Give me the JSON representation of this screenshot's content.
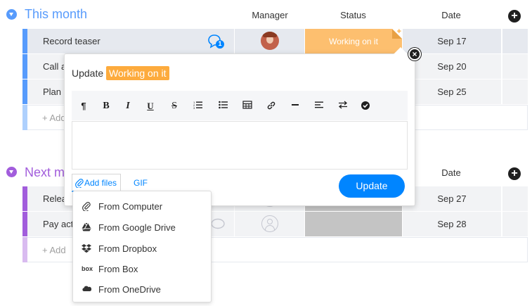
{
  "groups": [
    {
      "title": "This month",
      "color": "#579bfc",
      "columns": {
        "manager": "Manager",
        "status": "Status",
        "date": "Date"
      },
      "rows": [
        {
          "name": "Record teaser",
          "status": "Working on it",
          "date": "Sep 17",
          "update_count": "1"
        },
        {
          "name": "Call all",
          "date": "Sep 20"
        },
        {
          "name": "Plan co",
          "date": "Sep 25"
        }
      ],
      "add_label": "+ Add"
    },
    {
      "title": "Next m",
      "color": "#a25ddc",
      "columns": {
        "date": "Date"
      },
      "rows": [
        {
          "name": "Releas",
          "date": "Sep 27"
        },
        {
          "name": "Pay acto",
          "date": "Sep 28"
        }
      ],
      "add_label": "+ Add"
    }
  ],
  "popup": {
    "update_label": "Update",
    "status_label": "Working on it",
    "toolbar": [
      "paragraph",
      "bold",
      "italic",
      "underline",
      "strikethrough",
      "ordered-list",
      "bullet-list",
      "table",
      "link",
      "divider",
      "align-left",
      "direction",
      "check"
    ],
    "add_files_label": "Add files",
    "gif_label": "GIF",
    "update_button": "Update"
  },
  "file_menu": {
    "items": [
      {
        "label": "From Computer",
        "icon": "paperclip-icon"
      },
      {
        "label": "From Google Drive",
        "icon": "google-drive-icon"
      },
      {
        "label": "From Dropbox",
        "icon": "dropbox-icon"
      },
      {
        "label": "From Box",
        "icon": "box-icon"
      },
      {
        "label": "From OneDrive",
        "icon": "onedrive-icon"
      }
    ]
  },
  "colors": {
    "accent_blue": "#0085ff",
    "working_orange": "#fdab3d",
    "group1": "#579bfc",
    "group2": "#a25ddc"
  }
}
